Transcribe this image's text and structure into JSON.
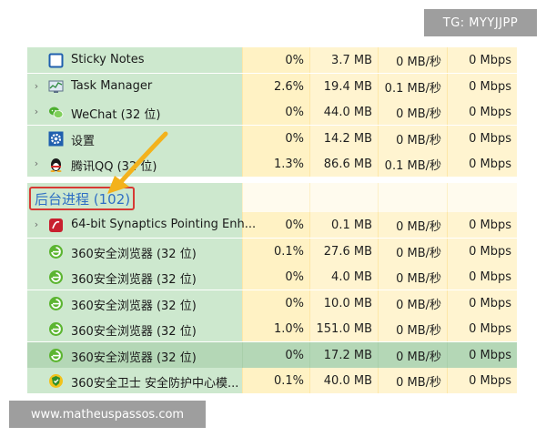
{
  "watermarks": {
    "top_right": "TG: MYYJJPP",
    "bottom_left": "www.matheuspassos.com"
  },
  "processes_top": [
    {
      "name": "Sticky Notes",
      "cpu": "0%",
      "memory": "3.7 MB",
      "disk": "0 MB/秒",
      "network": "0 Mbps",
      "icon": "sticky-notes-icon",
      "expandable": false
    },
    {
      "name": "Task Manager",
      "cpu": "2.6%",
      "memory": "19.4 MB",
      "disk": "0.1 MB/秒",
      "network": "0 Mbps",
      "icon": "task-manager-icon",
      "expandable": true
    },
    {
      "name": "WeChat (32 位)",
      "cpu": "0%",
      "memory": "44.0 MB",
      "disk": "0 MB/秒",
      "network": "0 Mbps",
      "icon": "wechat-icon",
      "expandable": true
    },
    {
      "name": "设置",
      "cpu": "0%",
      "memory": "14.2 MB",
      "disk": "0 MB/秒",
      "network": "0 Mbps",
      "icon": "settings-gear-icon",
      "expandable": false
    },
    {
      "name": "腾讯QQ (32 位)",
      "cpu": "1.3%",
      "memory": "86.6 MB",
      "disk": "0.1 MB/秒",
      "network": "0 Mbps",
      "icon": "qq-penguin-icon",
      "expandable": true
    }
  ],
  "background_group": {
    "title": "后台进程 (102)"
  },
  "processes_background": [
    {
      "name": "64-bit Synaptics Pointing Enh...",
      "cpu": "0%",
      "memory": "0.1 MB",
      "disk": "0 MB/秒",
      "network": "0 Mbps",
      "icon": "synaptics-icon",
      "expandable": true
    },
    {
      "name": "360安全浏览器 (32 位)",
      "cpu": "0.1%",
      "memory": "27.6 MB",
      "disk": "0 MB/秒",
      "network": "0 Mbps",
      "icon": "browser-360-icon",
      "expandable": false
    },
    {
      "name": "360安全浏览器 (32 位)",
      "cpu": "0%",
      "memory": "4.0 MB",
      "disk": "0 MB/秒",
      "network": "0 Mbps",
      "icon": "browser-360-icon",
      "expandable": false
    },
    {
      "name": "360安全浏览器 (32 位)",
      "cpu": "0%",
      "memory": "10.0 MB",
      "disk": "0 MB/秒",
      "network": "0 Mbps",
      "icon": "browser-360-icon",
      "expandable": false
    },
    {
      "name": "360安全浏览器 (32 位)",
      "cpu": "1.0%",
      "memory": "151.0 MB",
      "disk": "0 MB/秒",
      "network": "0 Mbps",
      "icon": "browser-360-icon",
      "expandable": false
    },
    {
      "name": "360安全浏览器 (32 位)",
      "cpu": "0%",
      "memory": "17.2 MB",
      "disk": "0 MB/秒",
      "network": "0 Mbps",
      "icon": "browser-360-icon",
      "expandable": false,
      "selected": true
    },
    {
      "name": "360安全卫士 安全防护中心模...",
      "cpu": "0.1%",
      "memory": "40.0 MB",
      "disk": "0 MB/秒",
      "network": "0 Mbps",
      "icon": "security-360-icon",
      "expandable": false
    }
  ],
  "colors": {
    "name_column_bg": "#cde8ce",
    "data_column_bg": "#fff4d0",
    "group_title_text": "#2f6fc4",
    "highlight_box": "#d73a34",
    "arrow": "#f3b21c"
  }
}
